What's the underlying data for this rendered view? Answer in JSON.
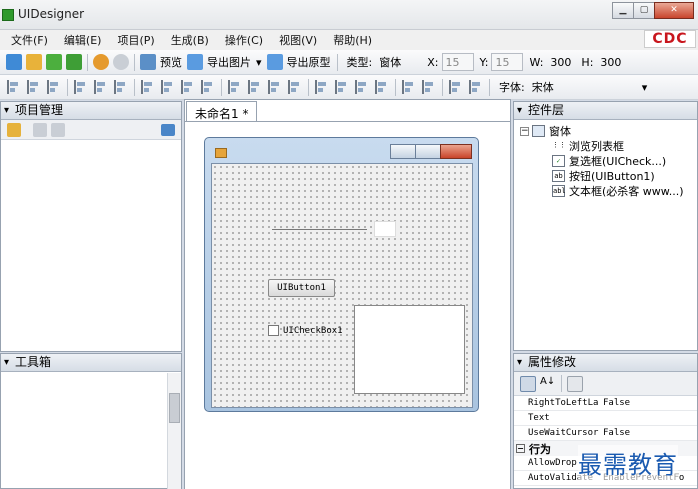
{
  "window": {
    "title": "UIDesigner",
    "logo": "CDC"
  },
  "menu": [
    "文件(F)",
    "编辑(E)",
    "项目(P)",
    "生成(B)",
    "操作(C)",
    "视图(V)",
    "帮助(H)"
  ],
  "toolbar": {
    "preview": "预览",
    "export_image": "导出图片",
    "export_prototype": "导出原型",
    "type_label": "类型:",
    "type_value": "窗体",
    "x_label": "X:",
    "x_value": "15",
    "y_label": "Y:",
    "y_value": "15",
    "w_label": "W:",
    "w_value": "300",
    "h_label": "H:",
    "h_value": "300",
    "font_label": "字体:",
    "font_value": "宋体"
  },
  "panels": {
    "project": "项目管理",
    "toolbox": "工具箱",
    "controls": "控件层",
    "properties": "属性修改"
  },
  "document_tab": "未命名1 *",
  "form": {
    "button": "UIButton1",
    "checkbox": "UICheckBox1"
  },
  "tree": {
    "root": "窗体",
    "items": [
      {
        "icon": "list",
        "label": "浏览列表框"
      },
      {
        "icon": "check",
        "label": "复选框(UICheck...)"
      },
      {
        "icon": "ab",
        "label": "按钮(UIButton1)"
      },
      {
        "icon": "abl",
        "label": "文本框(必杀客 www...)"
      }
    ]
  },
  "properties": [
    {
      "name": "RightToLeftLa",
      "value": "False"
    },
    {
      "name": "Text",
      "value": ""
    },
    {
      "name": "UseWaitCursor",
      "value": "False"
    }
  ],
  "property_group": "行为",
  "properties2": [
    {
      "name": "AllowDrop",
      "value": ""
    },
    {
      "name": "AutoValidate",
      "value": "EnablePreventFo"
    }
  ],
  "watermark": "最需教育",
  "colors": {
    "accent": "#1a5ab0",
    "logo": "#c8161d"
  }
}
